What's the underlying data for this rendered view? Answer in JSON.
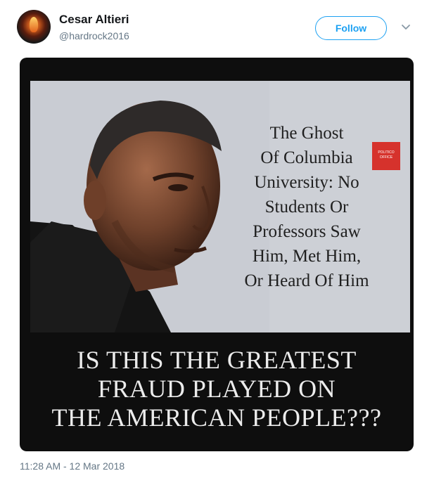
{
  "user": {
    "name": "Cesar Altieri",
    "handle": "@hardrock2016"
  },
  "actions": {
    "follow_label": "Follow"
  },
  "media": {
    "badge_line1": "POLITICO",
    "badge_line2": "OFFICE",
    "headline_lines": [
      "The Ghost",
      "Of Columbia",
      "University: No",
      "Students Or",
      "Professors Saw",
      "Him, Met Him,",
      "Or Heard Of Him"
    ],
    "caption_lines": [
      "IS THIS THE GREATEST",
      "FRAUD PLAYED ON",
      "THE AMERICAN PEOPLE???"
    ]
  },
  "tweet": {
    "timestamp": "11:28 AM - 12 Mar 2018"
  },
  "colors": {
    "accent": "#1da1f2",
    "text_primary": "#14171a",
    "text_secondary": "#657786"
  }
}
